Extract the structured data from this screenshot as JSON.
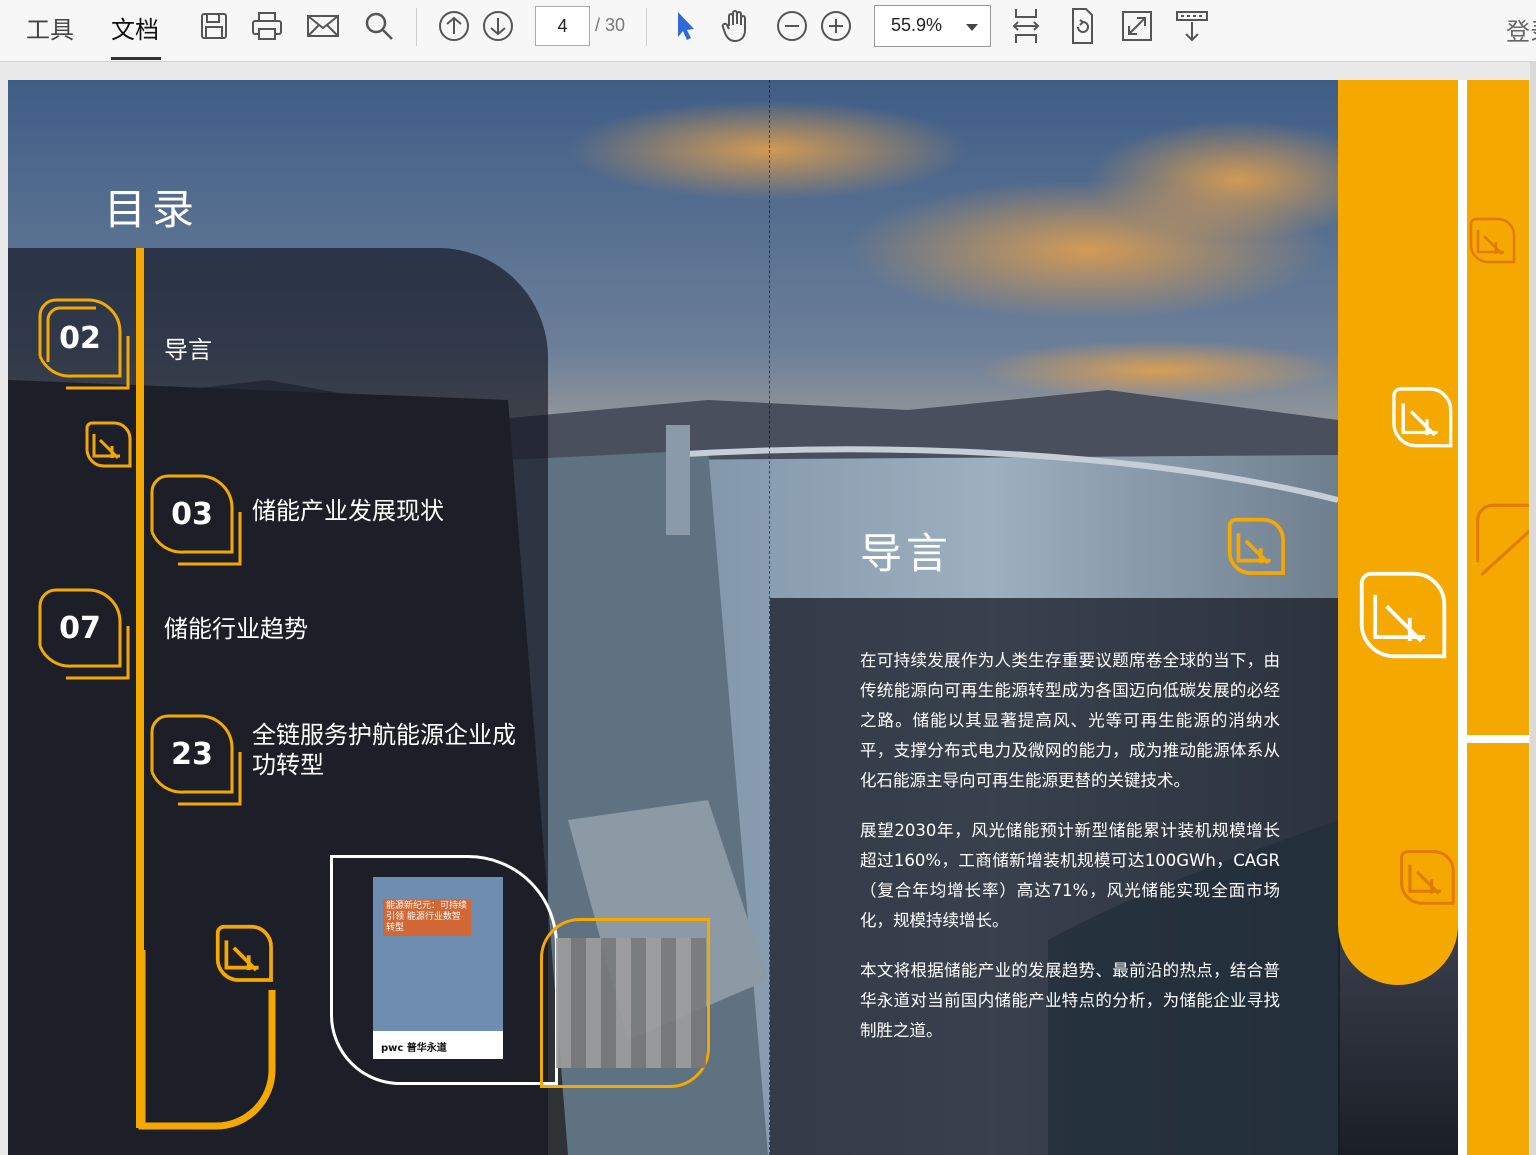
{
  "toolbar": {
    "tabs": [
      {
        "label": "工具"
      },
      {
        "label": "文档"
      }
    ],
    "page": {
      "current": "4",
      "total": "/ 30"
    },
    "zoom": "55.9%",
    "login": "登录",
    "icons": [
      "save-icon",
      "print-icon",
      "mail-icon",
      "search-icon",
      "prev-page-icon",
      "next-page-icon",
      "select-cursor-icon",
      "hand-tool-icon",
      "zoom-out-icon",
      "zoom-in-icon",
      "fit-page-icon",
      "rotate-icon",
      "fullscreen-icon",
      "read-mode-icon"
    ]
  },
  "document": {
    "toc": {
      "title": "目录",
      "items": [
        {
          "num": "02",
          "label": "导言"
        },
        {
          "num": "03",
          "label": "储能产业发展现状"
        },
        {
          "num": "07",
          "label": "储能行业趋势"
        },
        {
          "num": "23",
          "label": "全链服务护航能源企业成功转型"
        }
      ]
    },
    "cover": {
      "title": "能源新纪元：可持续引领 能源行业数智转型",
      "brand": "pwc 普华永道"
    },
    "intro": {
      "title": "导言",
      "paragraphs": [
        "在可持续发展作为人类生存重要议题席卷全球的当下，由传统能源向可再生能源转型成为各国迈向低碳发展的必经之路。储能以其显著提高风、光等可再生能源的消纳水平，支撑分布式电力及微网的能力，成为推动能源体系从化石能源主导向可再生能源更替的关键技术。",
        "展望2030年，风光储能预计新型储能累计装机规模增长超过160%，工商储新增装机规模可达100GWh，CAGR（复合年均增长率）高达71%，风光储能实现全面市场化，规模持续增长。",
        "本文将根据储能产业的发展趋势、最前沿的热点，结合普华永道对当前国内储能产业特点的分析，为储能企业寻找制胜之道。"
      ]
    }
  },
  "colors": {
    "accent": "#f5a800",
    "toolbar_bg": "#f7f7f7",
    "select_icon": "#2f6bd8"
  }
}
